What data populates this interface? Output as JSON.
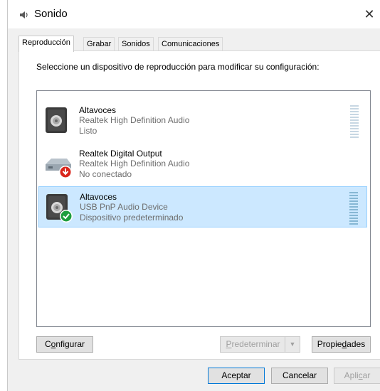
{
  "window": {
    "title": "Sonido",
    "icon": "speaker-icon",
    "close_glyph": "✕"
  },
  "tabs": [
    {
      "label": "Reproducción",
      "active": true
    },
    {
      "label": "Grabar",
      "active": false
    },
    {
      "label": "Sonidos",
      "active": false
    },
    {
      "label": "Comunicaciones",
      "active": false
    }
  ],
  "instructions": "Seleccione un dispositivo de reproducción para modificar su configuración:",
  "devices": [
    {
      "name": "Altavoces",
      "driver": "Realtek High Definition Audio",
      "status": "Listo",
      "icon": "speaker-icon",
      "badge": "none",
      "selected": false
    },
    {
      "name": "Realtek Digital Output",
      "driver": "Realtek High Definition Audio",
      "status": "No conectado",
      "icon": "digital-output-icon",
      "badge": "disconnected-arrow",
      "selected": false
    },
    {
      "name": "Altavoces",
      "driver": "USB PnP Audio Device",
      "status": "Dispositivo predeterminado",
      "icon": "speaker-icon",
      "badge": "default-check",
      "selected": true
    }
  ],
  "buttons": {
    "configure": {
      "pre": "C",
      "mnemonic": "o",
      "post": "nfigurar"
    },
    "set_default": {
      "pre": "",
      "mnemonic": "P",
      "post": "redeterminar"
    },
    "properties": {
      "pre": "Propie",
      "mnemonic": "d",
      "post": "ades"
    },
    "ok": "Aceptar",
    "cancel": "Cancelar",
    "apply": {
      "pre": "Apli",
      "mnemonic": "c",
      "post": "ar"
    }
  },
  "colors": {
    "selection_bg": "#cce8ff",
    "selection_border": "#99d1ff",
    "default_check": "#1e9e3e",
    "disconnected": "#d9261c"
  }
}
